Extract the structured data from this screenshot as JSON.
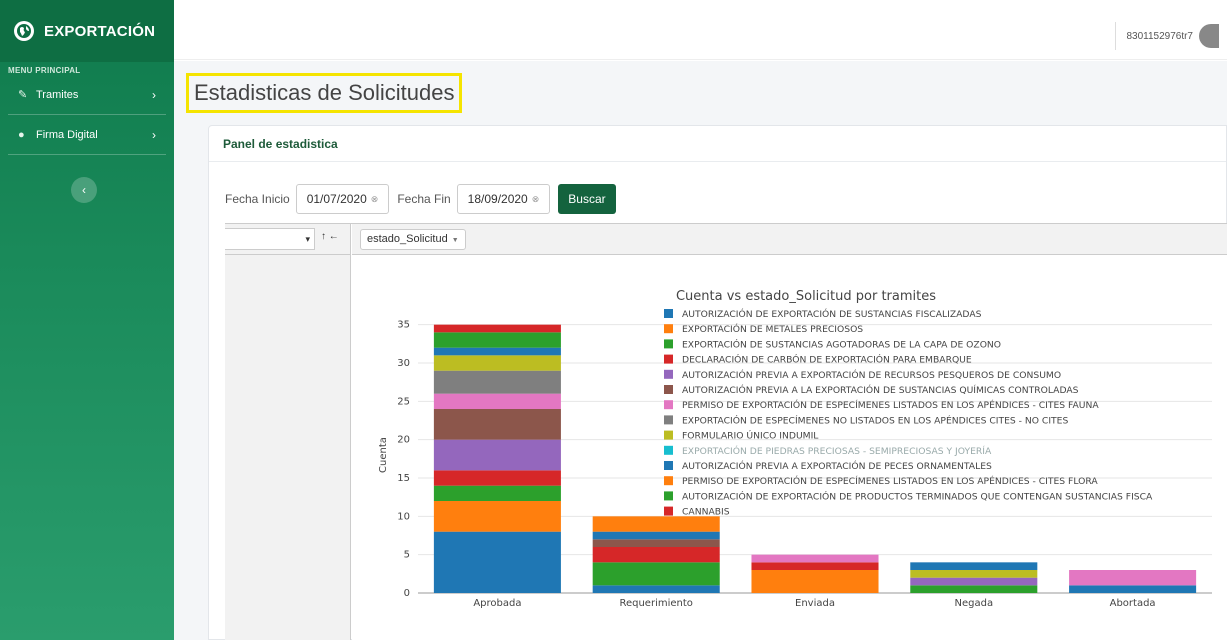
{
  "sidebar": {
    "brand": "EXPORTACIÓN",
    "menu_header": "MENU PRINCIPAL",
    "items": [
      {
        "label": "Tramites",
        "icon": "edit-icon"
      },
      {
        "label": "Firma Digital",
        "icon": "circle-icon"
      }
    ]
  },
  "topbar": {
    "user": "8301152976tr7"
  },
  "page": {
    "title": "Estadisticas de Solicitudes",
    "panel_title": "Panel de estadistica"
  },
  "filters": {
    "start_label": "Fecha Inicio",
    "start_value": "01/07/2020",
    "end_label": "Fecha Fin",
    "end_value": "18/09/2020",
    "search_label": "Buscar"
  },
  "pivot": {
    "arrows": "↑ ←",
    "column_field": "estado_Solicitud"
  },
  "chart_data": {
    "type": "bar",
    "stacked": true,
    "title": "Cuenta vs estado_Solicitud por tramites",
    "xlabel": "",
    "ylabel": "Cuenta",
    "ylim": [
      0,
      36
    ],
    "yticks": [
      0,
      5,
      10,
      15,
      20,
      25,
      30,
      35
    ],
    "grid": true,
    "legend": "top-right",
    "categories": [
      "Aprobada",
      "Requerimiento",
      "Enviada",
      "Negada",
      "Abortada"
    ],
    "series": [
      {
        "name": "AUTORIZACIÓN DE EXPORTACIÓN DE SUSTANCIAS FISCALIZADAS",
        "color": "#1f77b4",
        "values": [
          8,
          1,
          0,
          0,
          1
        ]
      },
      {
        "name": "EXPORTACIÓN DE METALES PRECIOSOS",
        "color": "#ff7f0e",
        "values": [
          4,
          0,
          3,
          0,
          0
        ]
      },
      {
        "name": "EXPORTACIÓN DE SUSTANCIAS AGOTADORAS DE LA CAPA DE OZONO",
        "color": "#2ca02c",
        "values": [
          2,
          3,
          0,
          1,
          0
        ]
      },
      {
        "name": "DECLARACIÓN DE CARBÓN DE EXPORTACIÓN PARA EMBARQUE",
        "color": "#d62728",
        "values": [
          2,
          2,
          1,
          0,
          0
        ]
      },
      {
        "name": "AUTORIZACIÓN PREVIA A EXPORTACIÓN DE RECURSOS PESQUEROS DE CONSUMO",
        "color": "#9467bd",
        "values": [
          4,
          0,
          0,
          1,
          0
        ]
      },
      {
        "name": "AUTORIZACIÓN PREVIA A LA EXPORTACIÓN DE SUSTANCIAS QUÍMICAS CONTROLADAS",
        "color": "#8c564b",
        "values": [
          4,
          1,
          0,
          0,
          0
        ]
      },
      {
        "name": "PERMISO DE EXPORTACIÓN DE ESPECÍMENES LISTADOS EN LOS APÉNDICES - CITES FAUNA",
        "color": "#e377c2",
        "values": [
          2,
          0,
          1,
          0,
          2
        ]
      },
      {
        "name": "EXPORTACIÓN DE ESPECÍMENES NO LISTADOS EN LOS APÉNDICES CITES - NO CITES",
        "color": "#7f7f7f",
        "values": [
          3,
          0,
          0,
          0,
          0
        ]
      },
      {
        "name": "FORMULARIO ÚNICO INDUMIL",
        "color": "#bcbd22",
        "values": [
          2,
          0,
          0,
          1,
          0
        ]
      },
      {
        "name": "EXPORTACIÓN DE PIEDRAS PRECIOSAS - SEMIPRECIOSAS Y JOYERÍA",
        "color": "#17becf",
        "values": [
          0,
          0,
          0,
          0,
          0
        ]
      },
      {
        "name": "AUTORIZACIÓN PREVIA A EXPORTACIÓN DE PECES ORNAMENTALES",
        "color": "#1f77b4",
        "values": [
          1,
          1,
          0,
          1,
          0
        ]
      },
      {
        "name": "PERMISO DE EXPORTACIÓN DE ESPECÍMENES LISTADOS EN LOS APÉNDICES - CITES FLORA",
        "color": "#ff7f0e",
        "values": [
          0,
          2,
          0,
          0,
          0
        ]
      },
      {
        "name": "AUTORIZACIÓN DE EXPORTACIÓN DE PRODUCTOS TERMINADOS QUE CONTENGAN SUSTANCIAS FISCA",
        "color": "#2ca02c",
        "values": [
          2,
          0,
          0,
          0,
          0
        ]
      },
      {
        "name": "CANNABIS",
        "color": "#d62728",
        "values": [
          1,
          0,
          0,
          0,
          0
        ]
      }
    ]
  }
}
